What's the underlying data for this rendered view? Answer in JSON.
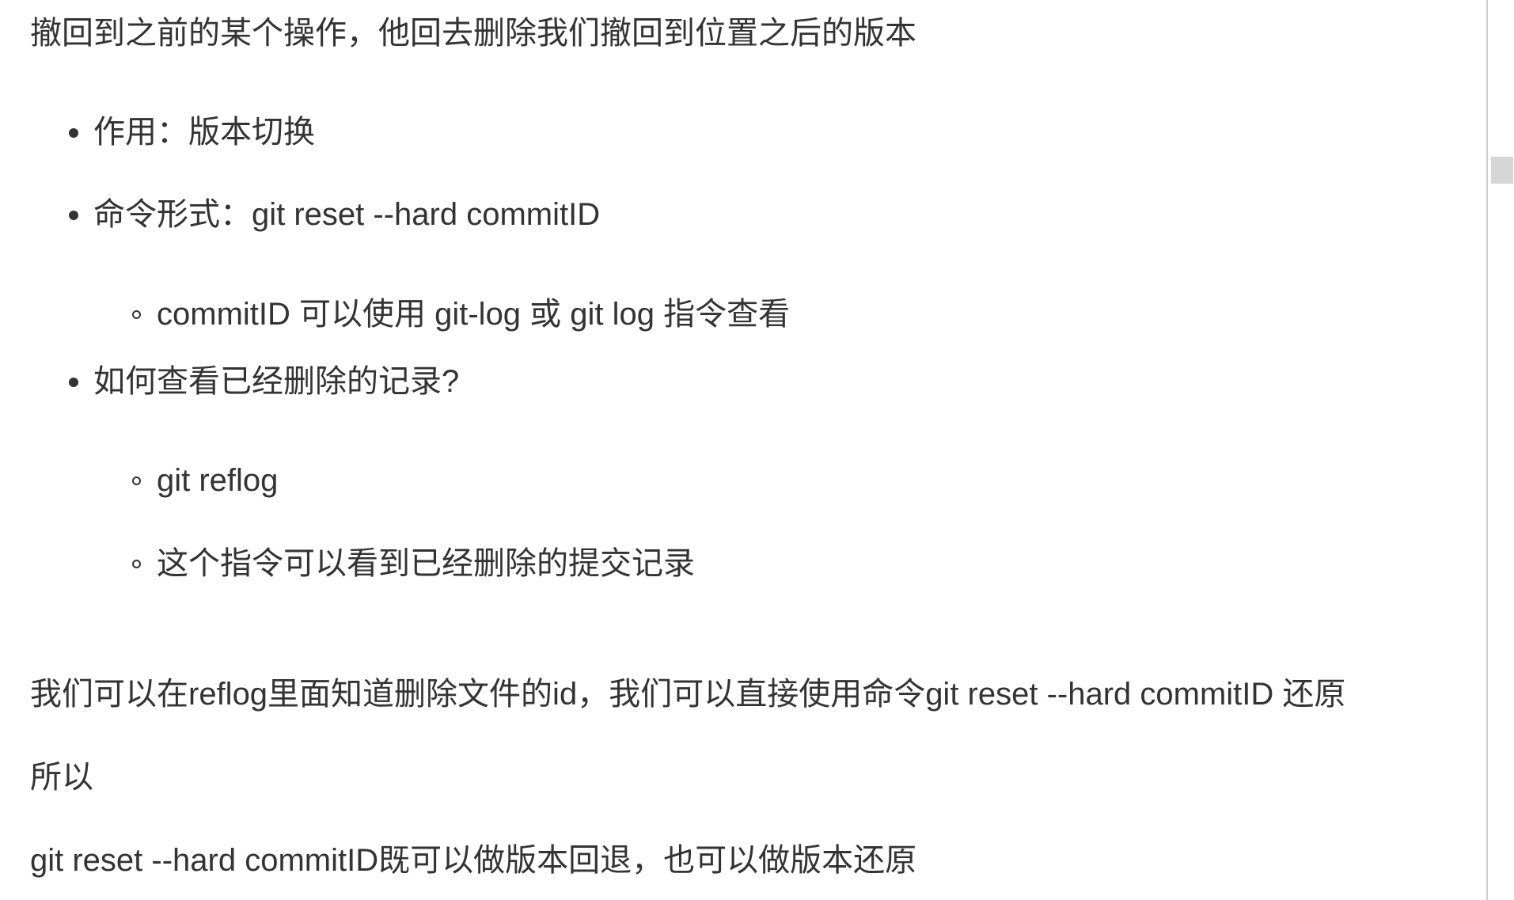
{
  "doc": {
    "line_intro": "撤回到之前的某个操作，他回去删除我们撤回到位置之后的版本",
    "list": [
      {
        "text": "作用：版本切换",
        "children": []
      },
      {
        "text": "命令形式：git reset --hard commitID",
        "children": [
          "commitID 可以使用 git-log 或 git log 指令查看"
        ]
      },
      {
        "text": "如何查看已经删除的记录?",
        "children": [
          "git reflog",
          "这个指令可以看到已经删除的提交记录"
        ]
      }
    ],
    "para_reflog": "我们可以在reflog里面知道删除文件的id，我们可以直接使用命令git reset --hard commitID 还原",
    "para_so": "所以",
    "para_summary": "git reset --hard commitID既可以做版本回退，也可以做版本还原"
  }
}
